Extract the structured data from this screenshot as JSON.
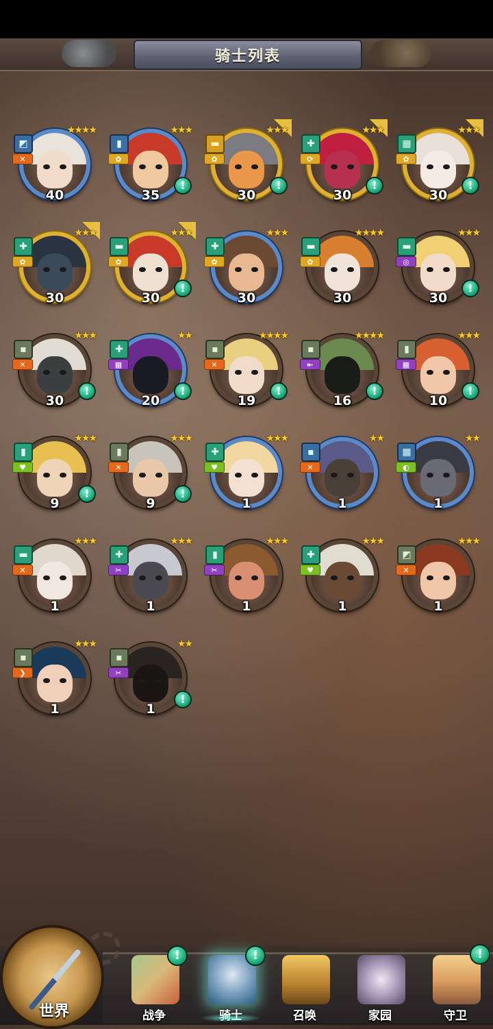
{
  "header": {
    "title": "骑士列表"
  },
  "heroes": [
    {
      "level": "40",
      "stars": "★★★★",
      "frame": "blue",
      "badge": "blue",
      "badge_icon": "◩",
      "role": "orange",
      "role_icon": "✕",
      "alert": false,
      "promote": false,
      "hair": "#e8e4dc",
      "skin": "#f0dcc8"
    },
    {
      "level": "35",
      "stars": "★★★",
      "frame": "blue",
      "badge": "blue",
      "badge_icon": "▮",
      "role": "gold",
      "role_icon": "✿",
      "alert": true,
      "promote": false,
      "hair": "#c83a28",
      "skin": "#f0c8a0"
    },
    {
      "level": "30",
      "stars": "★★★",
      "frame": "gold",
      "badge": "gold",
      "badge_icon": "▬",
      "role": "gold",
      "role_icon": "✿",
      "alert": true,
      "promote": true,
      "hair": "#7a7a80",
      "skin": "#e89848"
    },
    {
      "level": "30",
      "stars": "★★★",
      "frame": "gold",
      "badge": "teal",
      "badge_icon": "✚",
      "role": "gold",
      "role_icon": "⟳",
      "alert": true,
      "promote": true,
      "hair": "#c02040",
      "skin": "#b83050"
    },
    {
      "level": "30",
      "stars": "★★★",
      "frame": "gold",
      "badge": "teal",
      "badge_icon": "▦",
      "role": "gold",
      "role_icon": "✿",
      "alert": true,
      "promote": true,
      "hair": "#e8e0d8",
      "skin": "#f4ece4"
    },
    {
      "level": "30",
      "stars": "★★★",
      "frame": "gold",
      "badge": "teal",
      "badge_icon": "✚",
      "role": "gold",
      "role_icon": "✿",
      "alert": false,
      "promote": true,
      "hair": "#2a3440",
      "skin": "#3a4a58"
    },
    {
      "level": "30",
      "stars": "★★★",
      "frame": "gold",
      "badge": "teal",
      "badge_icon": "▬",
      "role": "gold",
      "role_icon": "✿",
      "alert": true,
      "promote": true,
      "hair": "#c83a28",
      "skin": "#f0e0d0"
    },
    {
      "level": "30",
      "stars": "★★★",
      "frame": "blue",
      "badge": "teal",
      "badge_icon": "✚",
      "role": "gold",
      "role_icon": "✿",
      "alert": false,
      "promote": false,
      "hair": "#6a4a30",
      "skin": "#e8b890"
    },
    {
      "level": "30",
      "stars": "★★★★",
      "frame": "brown",
      "badge": "teal",
      "badge_icon": "▬",
      "role": "gold",
      "role_icon": "✿",
      "alert": false,
      "promote": false,
      "hair": "#d88030",
      "skin": "#f0e4d8"
    },
    {
      "level": "30",
      "stars": "★★★",
      "frame": "brown",
      "badge": "teal",
      "badge_icon": "▬",
      "role": "purple",
      "role_icon": "◎",
      "alert": true,
      "promote": false,
      "hair": "#f0d070",
      "skin": "#f0dcc8"
    },
    {
      "level": "30",
      "stars": "★★★",
      "frame": "brown",
      "badge": "olive",
      "badge_icon": "▪",
      "role": "orange",
      "role_icon": "✕",
      "alert": true,
      "promote": false,
      "hair": "#e0dcd4",
      "skin": "#3a4040"
    },
    {
      "level": "20",
      "stars": "★★",
      "frame": "blue",
      "badge": "teal",
      "badge_icon": "✚",
      "role": "purple",
      "role_icon": "▦",
      "alert": true,
      "promote": false,
      "hair": "#6a2a8a",
      "skin": "#1a1a24"
    },
    {
      "level": "19",
      "stars": "★★★★",
      "frame": "brown",
      "badge": "olive",
      "badge_icon": "▪",
      "role": "orange",
      "role_icon": "✕",
      "alert": true,
      "promote": false,
      "hair": "#e8d080",
      "skin": "#f0dcc8"
    },
    {
      "level": "16",
      "stars": "★★★★",
      "frame": "brown",
      "badge": "olive",
      "badge_icon": "▪",
      "role": "purple",
      "role_icon": "⇤",
      "alert": true,
      "promote": false,
      "hair": "#6a8a50",
      "skin": "#1a1c18"
    },
    {
      "level": "10",
      "stars": "★★★",
      "frame": "brown",
      "badge": "olive",
      "badge_icon": "▮",
      "role": "purple",
      "role_icon": "▦",
      "alert": true,
      "promote": false,
      "hair": "#d86030",
      "skin": "#f0c8a8"
    },
    {
      "level": "9",
      "stars": "★★★",
      "frame": "brown",
      "badge": "teal",
      "badge_icon": "▮",
      "role": "green",
      "role_icon": "♥",
      "alert": true,
      "promote": false,
      "hair": "#e8c050",
      "skin": "#f0d4b8"
    },
    {
      "level": "9",
      "stars": "★★★",
      "frame": "brown",
      "badge": "olive",
      "badge_icon": "▮",
      "role": "orange",
      "role_icon": "✕",
      "alert": true,
      "promote": false,
      "hair": "#c8c4bc",
      "skin": "#e8c8a8"
    },
    {
      "level": "1",
      "stars": "★★★",
      "frame": "blue",
      "badge": "teal",
      "badge_icon": "✚",
      "role": "green",
      "role_icon": "♥",
      "alert": false,
      "promote": false,
      "hair": "#f0d8a0",
      "skin": "#f4e0d0"
    },
    {
      "level": "1",
      "stars": "★★",
      "frame": "blue",
      "badge": "blue",
      "badge_icon": "▪",
      "role": "orange",
      "role_icon": "✕",
      "alert": false,
      "promote": false,
      "hair": "#5a5a88",
      "skin": "#4a4038"
    },
    {
      "level": "1",
      "stars": "★★",
      "frame": "blue",
      "badge": "blue",
      "badge_icon": "▦",
      "role": "green",
      "role_icon": "◐",
      "alert": false,
      "promote": false,
      "hair": "#3a3a44",
      "skin": "#6a6a74"
    },
    {
      "level": "1",
      "stars": "★★★",
      "frame": "brown",
      "badge": "teal",
      "badge_icon": "▬",
      "role": "orange",
      "role_icon": "✕",
      "alert": false,
      "promote": false,
      "hair": "#e0d8cc",
      "skin": "#f0e8e0"
    },
    {
      "level": "1",
      "stars": "★★★",
      "frame": "brown",
      "badge": "teal",
      "badge_icon": "✚",
      "role": "purple",
      "role_icon": "✂",
      "alert": false,
      "promote": false,
      "hair": "#c8c8d0",
      "skin": "#4a4a50"
    },
    {
      "level": "1",
      "stars": "★★★",
      "frame": "brown",
      "badge": "teal",
      "badge_icon": "▮",
      "role": "purple",
      "role_icon": "✂",
      "alert": false,
      "promote": false,
      "hair": "#8a5a30",
      "skin": "#d89070"
    },
    {
      "level": "1",
      "stars": "★★★",
      "frame": "brown",
      "badge": "teal",
      "badge_icon": "✚",
      "role": "green",
      "role_icon": "♥",
      "alert": false,
      "promote": false,
      "hair": "#e0dcd0",
      "skin": "#6a4a34"
    },
    {
      "level": "1",
      "stars": "★★★",
      "frame": "brown",
      "badge": "olive",
      "badge_icon": "◩",
      "role": "orange",
      "role_icon": "✕",
      "alert": false,
      "promote": false,
      "hair": "#8a3a20",
      "skin": "#f0c8a8"
    },
    {
      "level": "1",
      "stars": "★★★",
      "frame": "brown",
      "badge": "olive",
      "badge_icon": "▪",
      "role": "orange",
      "role_icon": "❯",
      "alert": false,
      "promote": false,
      "hair": "#1a3a5a",
      "skin": "#f0d0b8"
    },
    {
      "level": "1",
      "stars": "★★",
      "frame": "brown",
      "badge": "olive",
      "badge_icon": "▪",
      "role": "purple",
      "role_icon": "✂",
      "alert": true,
      "promote": false,
      "hair": "#2a2420",
      "skin": "#1a1612"
    }
  ],
  "nav": {
    "world": "世界",
    "war": "战争",
    "knight": "骑士",
    "summon": "召唤",
    "home": "家园",
    "guard": "守卫"
  },
  "alert_glyph": "!"
}
